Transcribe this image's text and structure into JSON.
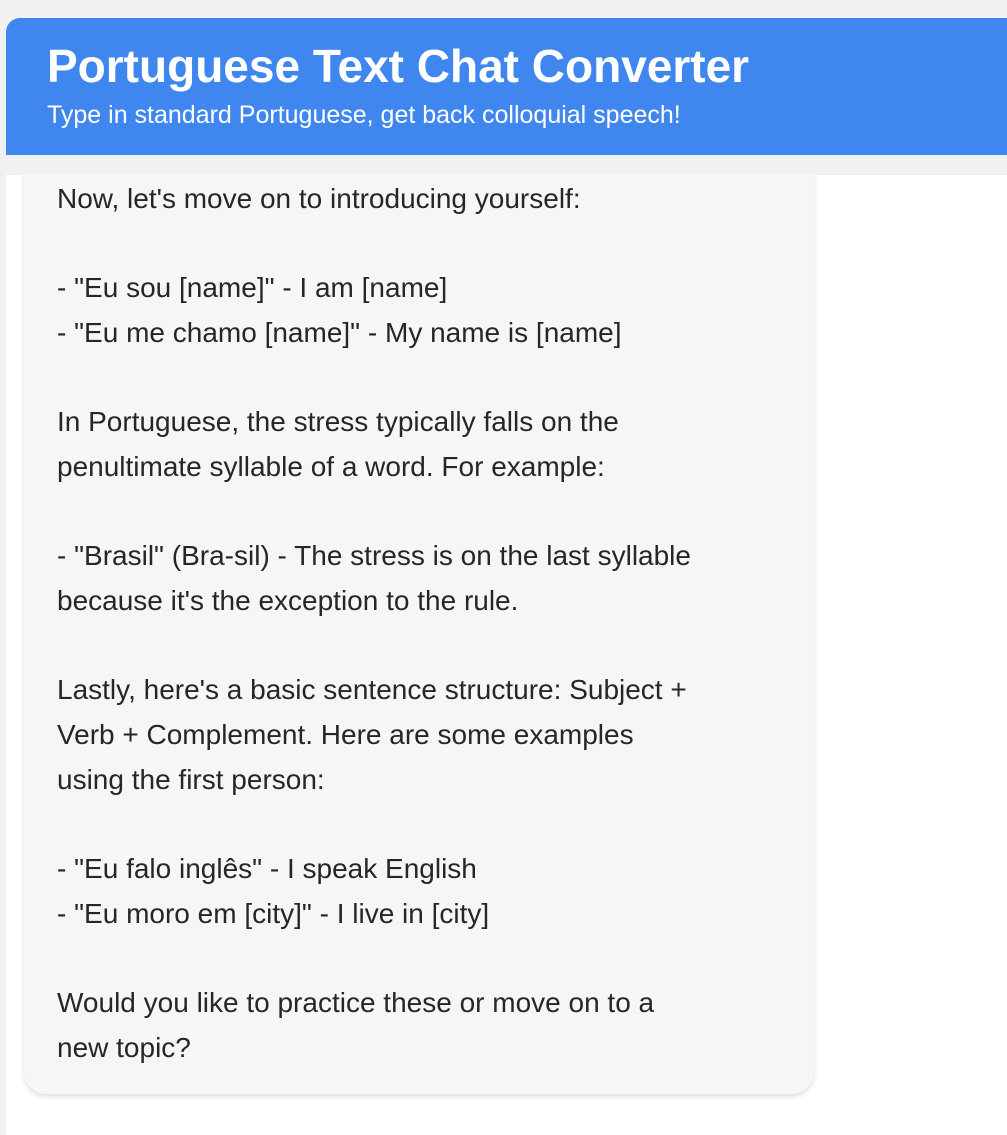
{
  "header": {
    "title": "Portuguese Text Chat Converter",
    "subtitle": "Type in standard Portuguese, get back colloquial speech!"
  },
  "message": {
    "lines": [
      "Now, let's move on to introducing yourself:",
      "",
      "- \"Eu sou [name]\" - I am [name]",
      "- \"Eu me chamo [name]\" - My name is [name]",
      "",
      "In Portuguese, the stress typically falls on the",
      "penultimate syllable of a word. For example:",
      "",
      "- \"Brasil\" (Bra-sil) - The stress is on the last syllable",
      "because it's the exception to the rule.",
      "",
      "Lastly, here's a basic sentence structure: Subject +",
      "Verb + Complement. Here are some examples",
      "using the first person:",
      "",
      "- \"Eu falo inglês\" - I speak English",
      "- \"Eu moro em [city]\" - I live in [city]",
      "",
      "Would you like to practice these or move on to a",
      "new topic?"
    ]
  },
  "colors": {
    "header_bg": "#3f86ef",
    "header_text": "#ffffff",
    "bubble_bg": "#f6f6f6",
    "text": "#262626"
  }
}
